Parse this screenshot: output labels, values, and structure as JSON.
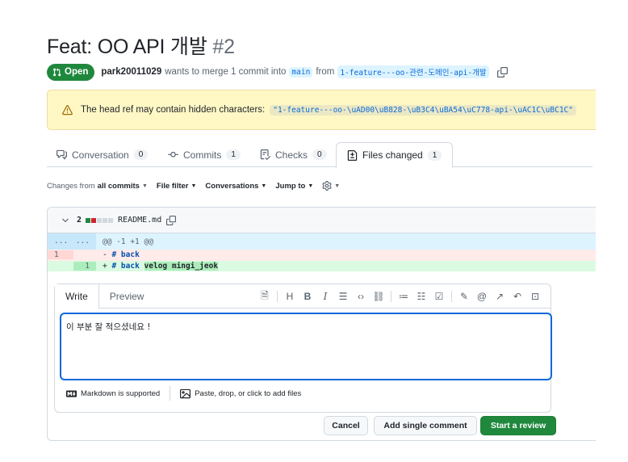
{
  "pr": {
    "title": "Feat: OO API 개발",
    "number": "#2",
    "state": "Open",
    "author": "park20011029",
    "merge_text": "wants to merge 1 commit into",
    "base_branch": "main",
    "from_text": "from",
    "head_branch": "1-feature---oo-관련-도메인-api-개발"
  },
  "warning": {
    "text": "The head ref may contain hidden characters:",
    "ref": "\"1-feature---oo-\\uAD00\\uB828-\\uB3C4\\uBA54\\uC778-api-\\uAC1C\\uBC1C\""
  },
  "tabs": [
    {
      "label": "Conversation",
      "count": "0",
      "icon": "comment-discussion-icon"
    },
    {
      "label": "Commits",
      "count": "1",
      "icon": "commit-icon"
    },
    {
      "label": "Checks",
      "count": "0",
      "icon": "checklist-icon"
    },
    {
      "label": "Files changed",
      "count": "1",
      "icon": "file-diff-icon",
      "active": true
    }
  ],
  "filters": {
    "changes_from_label": "Changes from",
    "changes_from_value": "all commits",
    "file_filter": "File filter",
    "conversations": "Conversations",
    "jump_to": "Jump to"
  },
  "file": {
    "changes": "2",
    "name": "README.md",
    "colors": {
      "added": "#1f883d",
      "removed": "#cf222e",
      "neutral": "#d1d9e0"
    }
  },
  "diff": {
    "hunk": {
      "n1": "...",
      "n2": "...",
      "text": "@@ -1 +1 @@"
    },
    "lines": [
      {
        "type": "del",
        "old": "1",
        "new": "",
        "sign": "-",
        "text": "# back",
        "extra": ""
      },
      {
        "type": "add",
        "old": "",
        "new": "1",
        "sign": "+",
        "text": "# back",
        "extra": "velog mingi_jeok"
      }
    ]
  },
  "comment": {
    "tab_write": "Write",
    "tab_preview": "Preview",
    "value": "이 부분 잘 적으셨네요 !",
    "markdown_note": "Markdown is supported",
    "attach_note": "Paste, drop, or click to add files",
    "tools": [
      "file-icon",
      "heading-icon",
      "bold-icon",
      "italic-icon",
      "quote-icon",
      "code-icon",
      "link-icon",
      "ordered-list-icon",
      "unordered-list-icon",
      "task-list-icon",
      "attach-icon",
      "mention-icon",
      "reference-icon",
      "undo-icon",
      "suggestion-icon"
    ]
  },
  "buttons": {
    "cancel": "Cancel",
    "single": "Add single comment",
    "review": "Start a review"
  }
}
